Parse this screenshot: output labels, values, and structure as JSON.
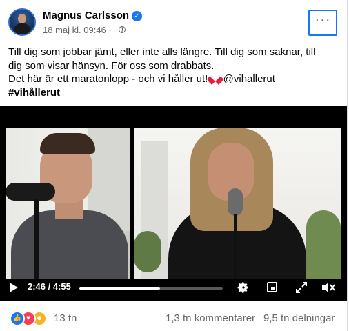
{
  "post": {
    "author": "Magnus Carlsson",
    "timestamp": "18 maj kl. 09:46 ·",
    "text_lines": [
      "Till dig som jobbar jämt, eller inte alls längre. Till dig som saknar, till",
      "dig som visar hänsyn. För oss som drabbats.",
      "Det här är ett maratonlopp - och vi håller ut!",
      "@vihallerut"
    ],
    "hashtag": "#vihållerut"
  },
  "video": {
    "current_time": "2:46",
    "separator": " / ",
    "duration": "4:55",
    "progress_fraction": 0.562
  },
  "footer": {
    "reaction_count": "13 tn",
    "comments": "1,3 tn kommentarer",
    "shares": "9,5 tn delningar"
  },
  "icons": {
    "verified": "verified-badge-icon",
    "audience": "globe-icon",
    "menu": "more-options-icon",
    "reactions": [
      "like-icon",
      "love-icon",
      "care-icon"
    ]
  },
  "colors": {
    "accent": "#1877f2",
    "heart": "#e41e3f",
    "secondary_text": "#65676b"
  }
}
